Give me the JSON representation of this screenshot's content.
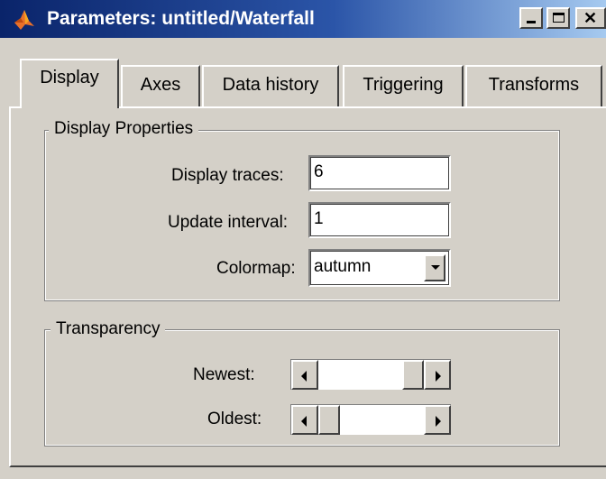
{
  "window": {
    "title": "Parameters: untitled/Waterfall"
  },
  "icons": {
    "app": "matlab-logo-icon",
    "minimize": "minimize-icon",
    "maximize": "maximize-icon",
    "close": "close-icon"
  },
  "tabs": [
    {
      "label": "Display",
      "active": true
    },
    {
      "label": "Axes"
    },
    {
      "label": "Data history"
    },
    {
      "label": "Triggering"
    },
    {
      "label": "Transforms"
    }
  ],
  "display_properties": {
    "title": "Display Properties",
    "traces_label": "Display traces:",
    "traces_value": "6",
    "update_label": "Update interval:",
    "update_value": "1",
    "colormap_label": "Colormap:",
    "colormap_value": "autumn"
  },
  "transparency": {
    "title": "Transparency",
    "newest_label": "Newest:",
    "newest_value": 1.0,
    "oldest_label": "Oldest:",
    "oldest_value": 0.0
  }
}
